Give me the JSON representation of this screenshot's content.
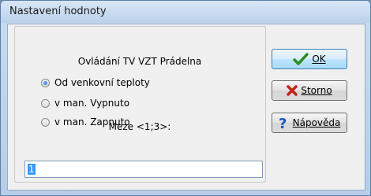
{
  "window": {
    "title": "Nastavení hodnoty"
  },
  "group": {
    "heading": "Ovládání TV VZT Prádelna",
    "options": [
      {
        "label": "Od venkovní teploty",
        "selected": true
      },
      {
        "label": "v man. Vypnuto",
        "selected": false
      },
      {
        "label": "v man. Zapnuto",
        "selected": false
      }
    ],
    "meze_label": "Meze <1;3>:",
    "value": "1"
  },
  "buttons": {
    "ok": {
      "label": "OK",
      "icon": "check-icon"
    },
    "storno": {
      "label": "Storno",
      "icon": "x-icon"
    },
    "napoveda": {
      "label": "Nápověda",
      "icon": "question-icon"
    }
  },
  "colors": {
    "check": "#2e8b1e",
    "cross": "#c0261a",
    "question": "#1b56b8",
    "selection": "#3399ff"
  }
}
